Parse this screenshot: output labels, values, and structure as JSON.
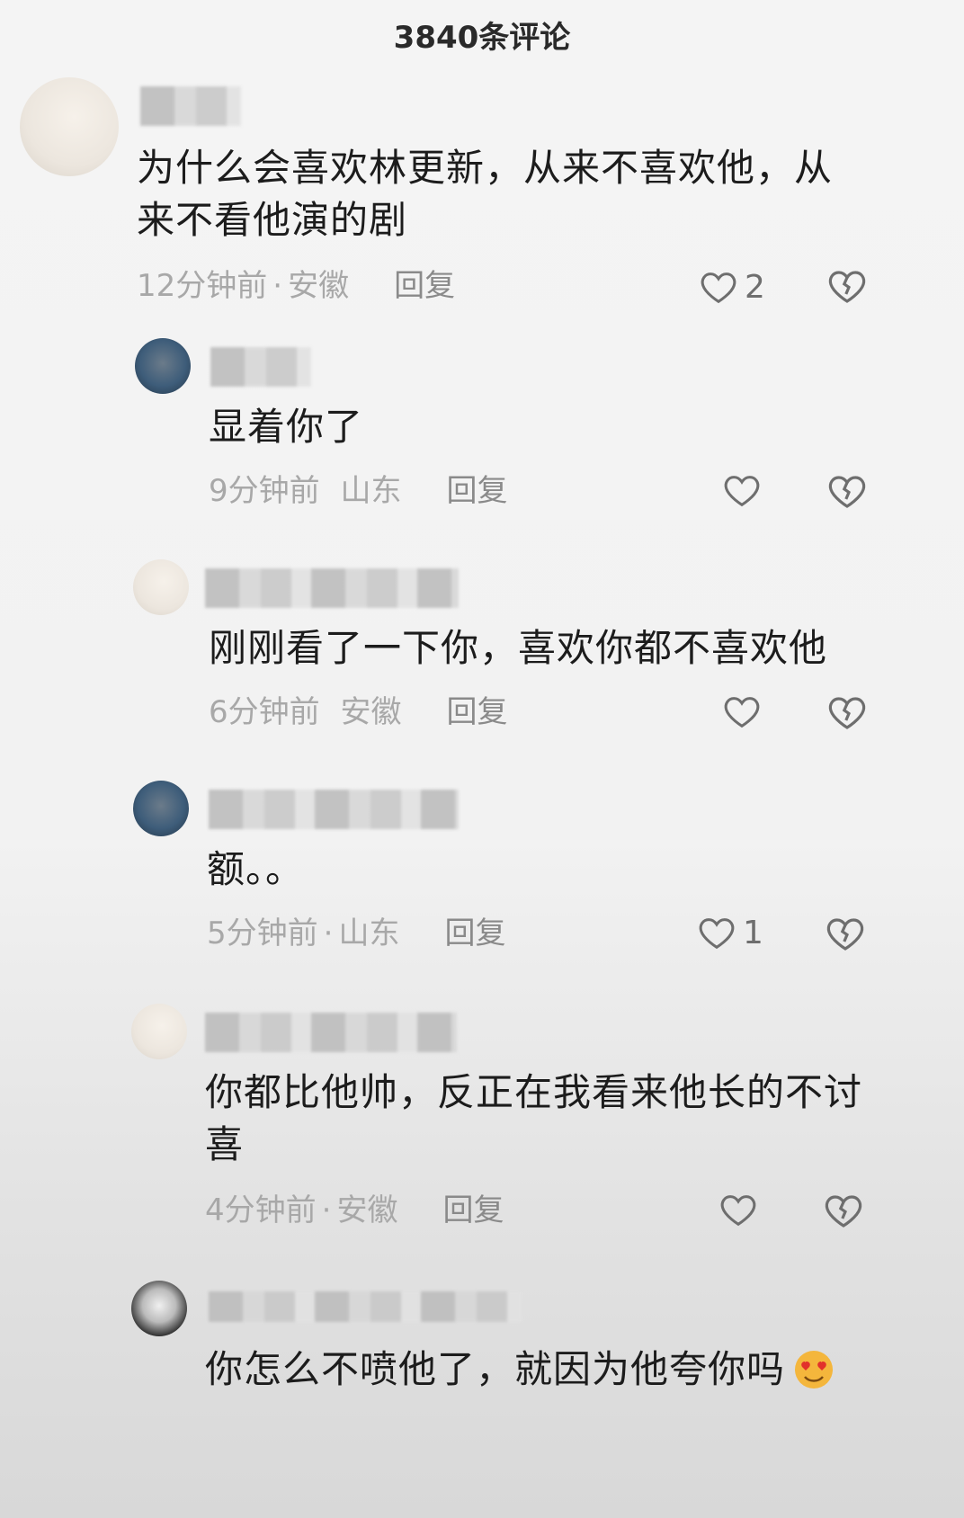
{
  "header": {
    "title": "3840条评论"
  },
  "comments": [
    {
      "text_lines": [
        "为什么会喜欢林更新，从来不喜欢他，从",
        "来不看他演的剧"
      ],
      "time": "12分钟前",
      "location": "安徽",
      "reply_label": "回复",
      "likes": "2"
    },
    {
      "text_lines": [
        "显着你了"
      ],
      "time": "9分钟前",
      "location": "山东",
      "reply_label": "回复",
      "likes": ""
    },
    {
      "text_lines": [
        "刚刚看了一下你，喜欢你都不喜欢他"
      ],
      "time": "6分钟前",
      "location": "安徽",
      "reply_label": "回复",
      "likes": ""
    },
    {
      "text_lines": [
        "额。。"
      ],
      "time": "5分钟前",
      "location": "山东",
      "reply_label": "回复",
      "likes": "1"
    },
    {
      "text_lines": [
        "你都比他帅，反正在我看来他长的不讨",
        "喜"
      ],
      "time": "4分钟前",
      "location": "安徽",
      "reply_label": "回复",
      "likes": ""
    },
    {
      "text_lines": [
        "你怎么不喷他了，就因为他夸你吗"
      ],
      "time": "",
      "location": "",
      "reply_label": "",
      "likes": ""
    }
  ],
  "icons": {
    "like": "heart-outline-icon",
    "dislike": "broken-heart-outline-icon",
    "emoji": "heart-eyes-emoji-icon"
  },
  "colors": {
    "icon_stroke": "#6e6e6e",
    "meta_text": "#a8a8a8"
  }
}
